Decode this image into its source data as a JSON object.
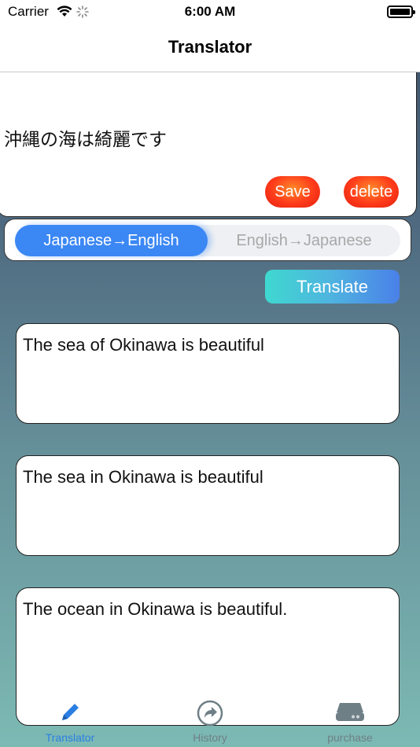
{
  "status_bar": {
    "carrier": "Carrier",
    "time": "6:00 AM"
  },
  "nav": {
    "title": "Translator"
  },
  "input": {
    "text": "沖縄の海は綺麗です"
  },
  "buttons": {
    "save": "Save",
    "delete": "delete",
    "translate": "Translate"
  },
  "segment": {
    "options": [
      "Japanese→English",
      "English→Japanese"
    ],
    "selected": "Japanese→English"
  },
  "results": [
    "The sea of Okinawa is beautiful",
    "The sea in Okinawa is beautiful",
    "The ocean in Okinawa is beautiful."
  ],
  "tabs": [
    {
      "label": "Translator",
      "icon": "pencil-icon"
    },
    {
      "label": "History",
      "icon": "share-arrow-icon"
    },
    {
      "label": "purchase",
      "icon": "hard-drive-icon"
    }
  ],
  "colors": {
    "accent": "#3b87f4",
    "save_delete": "#ff3b1a",
    "tab_active": "#2b7fe3"
  }
}
